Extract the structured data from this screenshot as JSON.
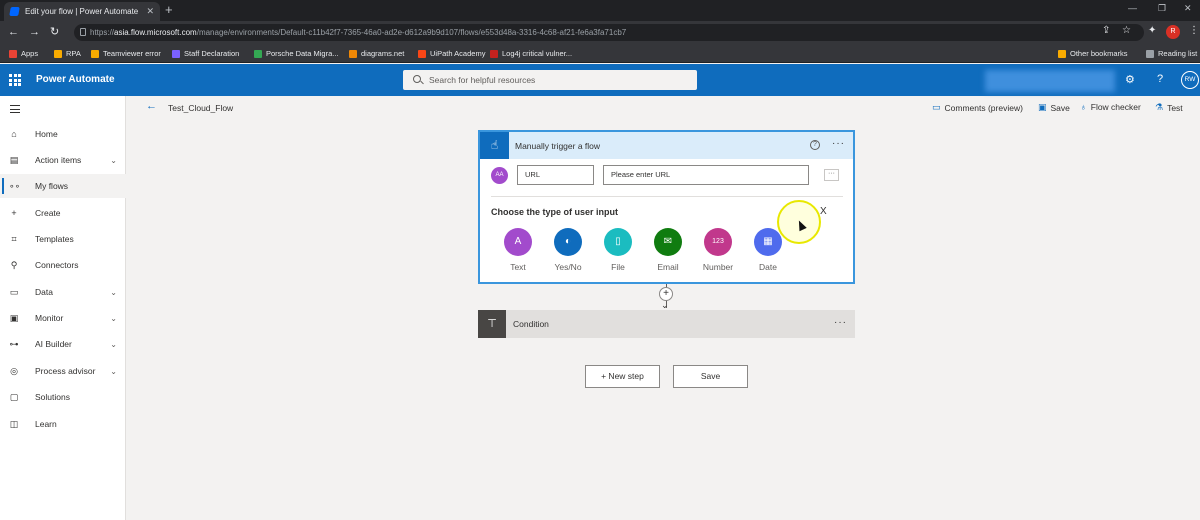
{
  "browser": {
    "tab_title": "Edit your flow | Power Automate",
    "url_host": "asia.flow.microsoft.com",
    "url_prefix": "https://",
    "url_path": "/manage/environments/Default-c11b42f7-7365-46a0-ad2e-d612a9b9d107/flows/e553d48a-3316-4c68-af21-fe6a3fa71cb7",
    "profile_initial": "R",
    "bookmarks": [
      "Apps",
      "RPA",
      "Teamviewer error",
      "Staff Declaration",
      "Porsche Data Migra...",
      "diagrams.net",
      "UiPath Academy",
      "Log4j critical vulner..."
    ],
    "other_bookmarks": "Other bookmarks",
    "reading_list": "Reading list"
  },
  "header": {
    "app_title": "Power Automate",
    "search_placeholder": "Search for helpful resources",
    "avatar_initials": "RW"
  },
  "sidebar": {
    "items": [
      {
        "label": "Home",
        "icon": "home-icon",
        "expandable": false
      },
      {
        "label": "Action items",
        "icon": "clipboard-icon",
        "expandable": true
      },
      {
        "label": "My flows",
        "icon": "flows-icon",
        "expandable": false,
        "active": true
      },
      {
        "label": "Create",
        "icon": "plus-icon",
        "expandable": false
      },
      {
        "label": "Templates",
        "icon": "templates-icon",
        "expandable": false
      },
      {
        "label": "Connectors",
        "icon": "connectors-icon",
        "expandable": false
      },
      {
        "label": "Data",
        "icon": "data-icon",
        "expandable": true
      },
      {
        "label": "Monitor",
        "icon": "monitor-icon",
        "expandable": true
      },
      {
        "label": "AI Builder",
        "icon": "ai-builder-icon",
        "expandable": true
      },
      {
        "label": "Process advisor",
        "icon": "process-advisor-icon",
        "expandable": true
      },
      {
        "label": "Solutions",
        "icon": "solutions-icon",
        "expandable": false
      },
      {
        "label": "Learn",
        "icon": "learn-icon",
        "expandable": false
      }
    ]
  },
  "commandbar": {
    "flow_name": "Test_Cloud_Flow",
    "comments": "Comments (preview)",
    "save": "Save",
    "flow_checker": "Flow checker",
    "test": "Test"
  },
  "trigger": {
    "title": "Manually trigger a flow",
    "input_icon_text": "AA",
    "input_name": "URL",
    "input_placeholder": "Please enter URL",
    "more": "···",
    "choose_label": "Choose the type of user input",
    "close": "X",
    "options": [
      {
        "label": "Text",
        "icon": "text-icon",
        "color": "#a24bcc",
        "glyph": "A"
      },
      {
        "label": "Yes/No",
        "icon": "yes-no-icon",
        "color": "#0f6cbd",
        "glyph": "◐"
      },
      {
        "label": "File",
        "icon": "file-icon",
        "color": "#1bbcc0",
        "glyph": "▯"
      },
      {
        "label": "Email",
        "icon": "email-icon",
        "color": "#107c10",
        "glyph": "✉"
      },
      {
        "label": "Number",
        "icon": "number-icon",
        "color": "#c1388c",
        "glyph": "123"
      },
      {
        "label": "Date",
        "icon": "date-icon",
        "color": "#4f6bed",
        "glyph": "▦"
      }
    ]
  },
  "condition": {
    "title": "Condition"
  },
  "actions": {
    "new_step": "+ New step",
    "save": "Save"
  },
  "colors": {
    "brand": "#0f6cbd",
    "card_border": "#3a96dd",
    "card_header": "#daecfa"
  }
}
